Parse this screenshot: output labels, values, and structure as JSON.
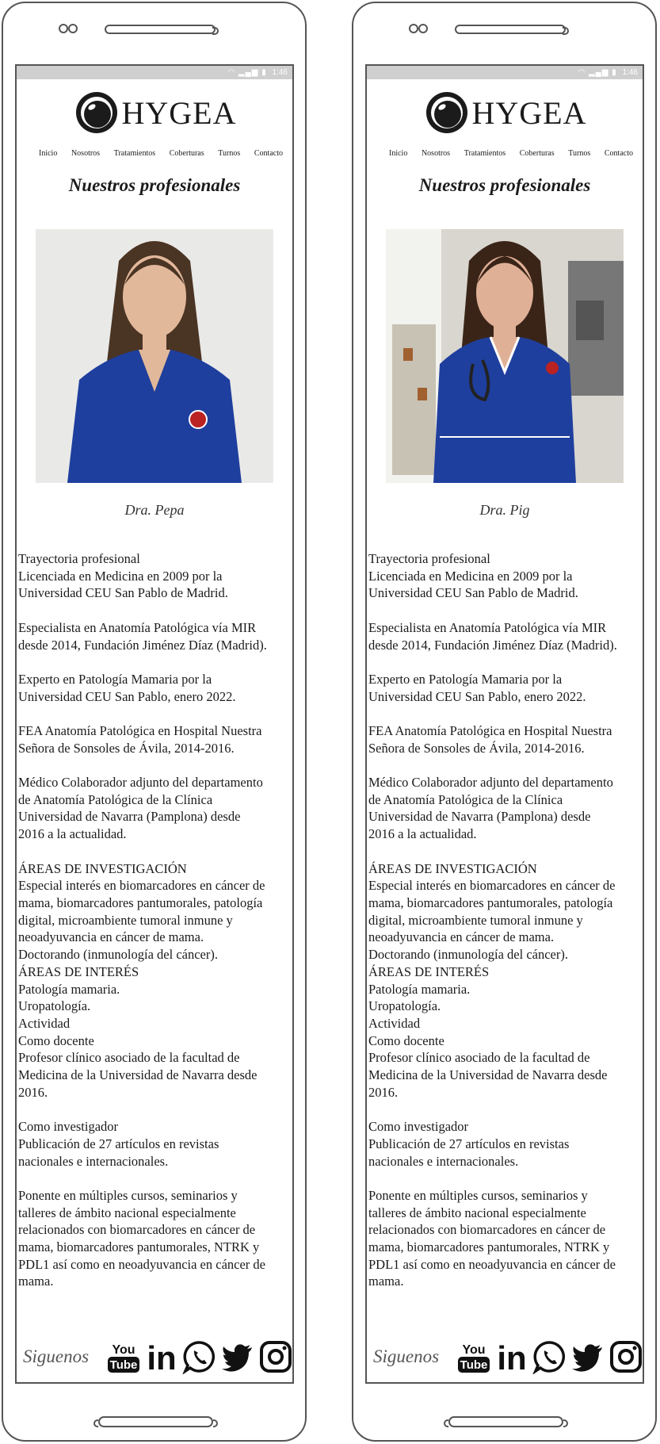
{
  "status_bar": {
    "time": "1:46"
  },
  "brand": {
    "name": "HYGEA"
  },
  "nav": [
    "Inicio",
    "Nosotros",
    "Tratamientos",
    "Coberturas",
    "Turnos",
    "Contacto"
  ],
  "section_title": "Nuestros profesionales",
  "screens": [
    {
      "doctor_name": "Dra. Pepa",
      "photo_alt": "doctor-photo"
    },
    {
      "doctor_name": "Dra. Pig",
      "photo_alt": "doctor-photo"
    }
  ],
  "bio": [
    [
      "Trayectoria profesional",
      "Licenciada en Medicina en 2009 por la",
      "Universidad CEU San Pablo de Madrid."
    ],
    [
      "Especialista en Anatomía Patológica vía MIR",
      "desde 2014, Fundación Jiménez Díaz (Madrid)."
    ],
    [
      "Experto en Patología Mamaria por la",
      "Universidad CEU San Pablo, enero 2022."
    ],
    [
      "FEA Anatomía Patológica en Hospital Nuestra",
      "Señora de Sonsoles de Ávila, 2014-2016."
    ],
    [
      "Médico Colaborador adjunto del departamento",
      "de Anatomía Patológica de la Clínica",
      "Universidad de Navarra (Pamplona) desde",
      "2016 a la actualidad."
    ],
    [
      "ÁREAS DE INVESTIGACIÓN",
      "Especial interés en biomarcadores en cáncer de",
      "mama, biomarcadores pantumorales, patología",
      "digital, microambiente tumoral inmune y",
      "neoadyuvancia en cáncer de mama.",
      "Doctorando (inmunología del cáncer).",
      "ÁREAS DE INTERÉS",
      "Patología mamaria.",
      "Uropatología.",
      "Actividad",
      "Como docente",
      "Profesor clínico asociado de la facultad de",
      "Medicina de la Universidad de Navarra desde",
      "2016."
    ],
    [
      "Como investigador",
      "Publicación de 27 artículos en revistas",
      "nacionales e internacionales."
    ],
    [
      "Ponente en múltiples cursos, seminarios y",
      "talleres de ámbito nacional especialmente",
      "relacionados con biomarcadores en cáncer de",
      "mama, biomarcadores pantumorales, NTRK y",
      "PDL1 así como en neoadyuvancia en cáncer de",
      "mama."
    ]
  ],
  "footer": {
    "follow_label": "Siguenos",
    "social_icons": [
      "youtube-icon",
      "linkedin-icon",
      "whatsapp-icon",
      "twitter-icon",
      "instagram-icon"
    ],
    "youtube_you": "You",
    "youtube_tube": "Tube",
    "linkedin_text": "in"
  },
  "colors": {
    "frame": "#555555",
    "status_bar": "#cfcfcf",
    "scrubs": "#1f3f9e",
    "text": "#1b1b1b"
  }
}
